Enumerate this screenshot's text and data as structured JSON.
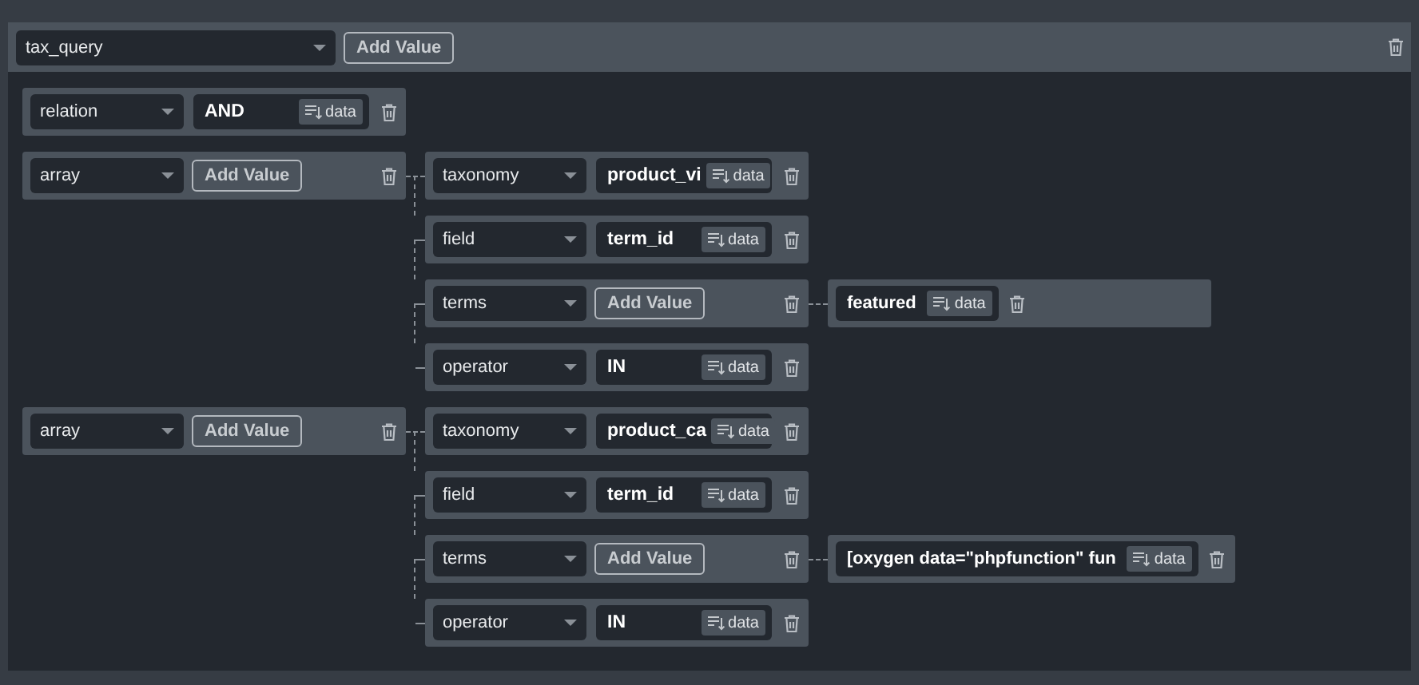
{
  "root": {
    "key": "tax_query",
    "button": "Add Value",
    "children": [
      {
        "kind": "value",
        "key": "relation",
        "value": "AND",
        "data_button": "data"
      },
      {
        "kind": "array",
        "key": "array",
        "button": "Add Value",
        "children": [
          {
            "kind": "value",
            "key": "taxonomy",
            "value": "product_vi",
            "data_button": "data"
          },
          {
            "kind": "value",
            "key": "field",
            "value": "term_id",
            "data_button": "data"
          },
          {
            "kind": "array",
            "key": "terms",
            "button": "Add Value",
            "children": [
              {
                "kind": "item",
                "value": "featured",
                "data_button": "data"
              }
            ]
          },
          {
            "kind": "value",
            "key": "operator",
            "value": "IN",
            "data_button": "data"
          }
        ]
      },
      {
        "kind": "array",
        "key": "array",
        "button": "Add Value",
        "children": [
          {
            "kind": "value",
            "key": "taxonomy",
            "value": "product_ca",
            "data_button": "data"
          },
          {
            "kind": "value",
            "key": "field",
            "value": "term_id",
            "data_button": "data"
          },
          {
            "kind": "array",
            "key": "terms",
            "button": "Add Value",
            "children": [
              {
                "kind": "item",
                "value": "[oxygen data=\"phpfunction\" fun",
                "data_button": "data"
              }
            ]
          },
          {
            "kind": "value",
            "key": "operator",
            "value": "IN",
            "data_button": "data"
          }
        ]
      }
    ]
  }
}
